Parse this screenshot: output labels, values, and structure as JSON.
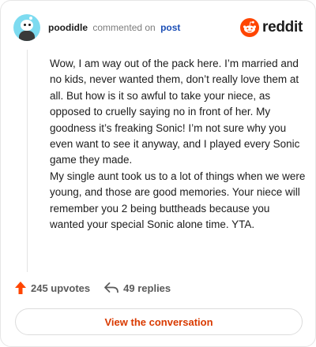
{
  "header": {
    "username": "poodidle",
    "action": "commented on",
    "post_link": "post",
    "brand": "reddit",
    "brand_color": "#ff4500"
  },
  "comment": {
    "paragraphs": [
      "Wow, I am way out of the pack here. I’m married and no kids, never wanted them, don’t really love them at all. But how is it so awful to take your niece, as opposed to cruelly saying no in front of her. My goodness it’s freaking Sonic! I’m not sure why you even want to see it anyway, and I played every Sonic game they made.",
      "My single aunt took us to a lot of things when we were young, and those are good memories. Your niece will remember you 2 being buttheads because you wanted your special Sonic alone time. YTA."
    ]
  },
  "stats": {
    "upvotes": "245 upvotes",
    "replies": "49 replies",
    "upvote_icon": "upvote-arrow-icon",
    "reply_icon": "reply-arrow-icon"
  },
  "cta": {
    "label": "View the conversation",
    "color": "#d93a00"
  }
}
